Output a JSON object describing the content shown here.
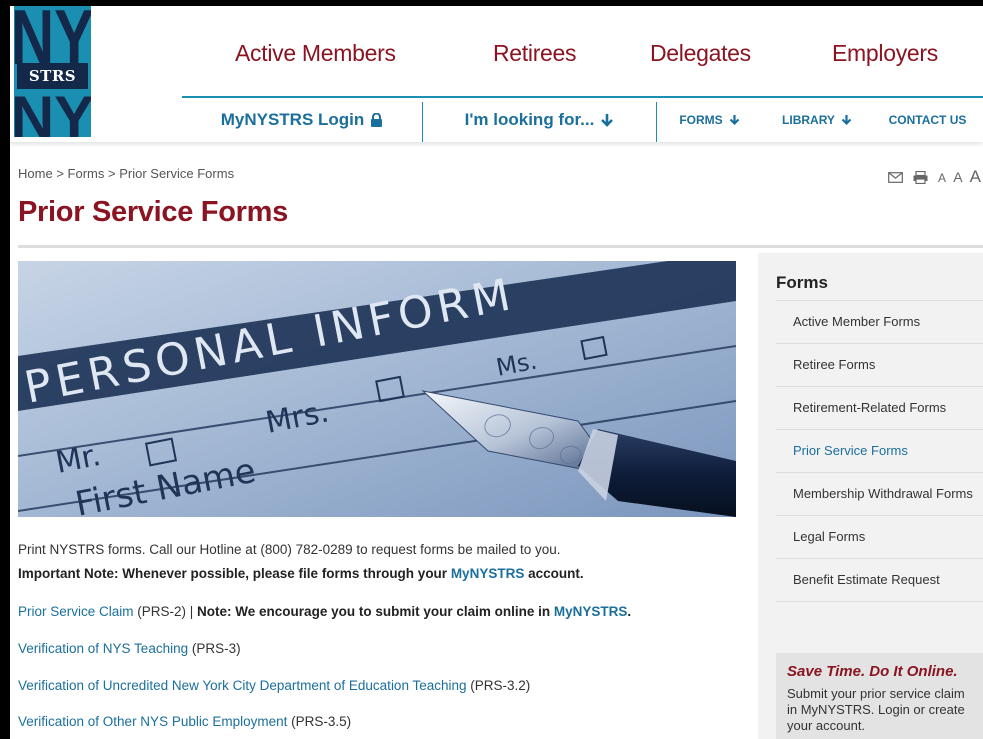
{
  "logo": {
    "mark": "NY",
    "text": "STRS"
  },
  "mainnav": [
    "Active Members",
    "Retirees",
    "Delegates",
    "Employers"
  ],
  "subnav": {
    "login": "MyNYSTRS Login",
    "looking": "I'm looking for...",
    "forms": "FORMS",
    "library": "LIBRARY",
    "contact": "CONTACT US"
  },
  "breadcrumb": [
    "Home",
    "Forms",
    "Prior Service Forms"
  ],
  "breadcrumb_sep": ">",
  "tools": {
    "email_icon": "envelope-icon",
    "print_icon": "printer-icon",
    "text_size": [
      "A",
      "A",
      "A"
    ]
  },
  "page_title": "Prior Service Forms",
  "hero": {
    "line1": "PERSONAL INFORM",
    "line2": "Mrs.",
    "line3": "Mr.",
    "line4": "Ms.",
    "line5": "First Name"
  },
  "content": {
    "intro": "Print NYSTRS forms. Call our Hotline at (800) 782-0289 to request forms be mailed to you.",
    "note_a": "Important Note: Whenever possible, please file forms through your ",
    "note_link": "MyNYSTRS",
    "note_b": " account.",
    "items": [
      {
        "link": "Prior Service Claim",
        "code": " (PRS-2) | ",
        "note": "Note: We encourage you to submit your claim online in ",
        "note_link": "MyNYSTRS",
        "end": "."
      },
      {
        "link": "Verification of NYS Teaching",
        "code": " (PRS-3)"
      },
      {
        "link": "Verification of Uncredited New York City Department of Education Teaching",
        "code": " (PRS-3.2)"
      },
      {
        "link": "Verification of Other NYS Public Employment",
        "code": " (PRS-3.5)"
      }
    ]
  },
  "sidebar": {
    "title": "Forms",
    "items": [
      "Active Member Forms",
      "Retiree Forms",
      "Retirement-Related Forms",
      "Prior Service Forms",
      "Membership Withdrawal Forms",
      "Legal Forms",
      "Benefit Estimate Request"
    ],
    "active_index": 3,
    "promo_title": "Save Time. Do It Online.",
    "promo_text": "Submit your prior service claim in MyNYSTRS. Login or create your account."
  },
  "colors": {
    "maroon": "#8a1421",
    "blue": "#1b6f9c",
    "teal": "#1b8fb1"
  }
}
